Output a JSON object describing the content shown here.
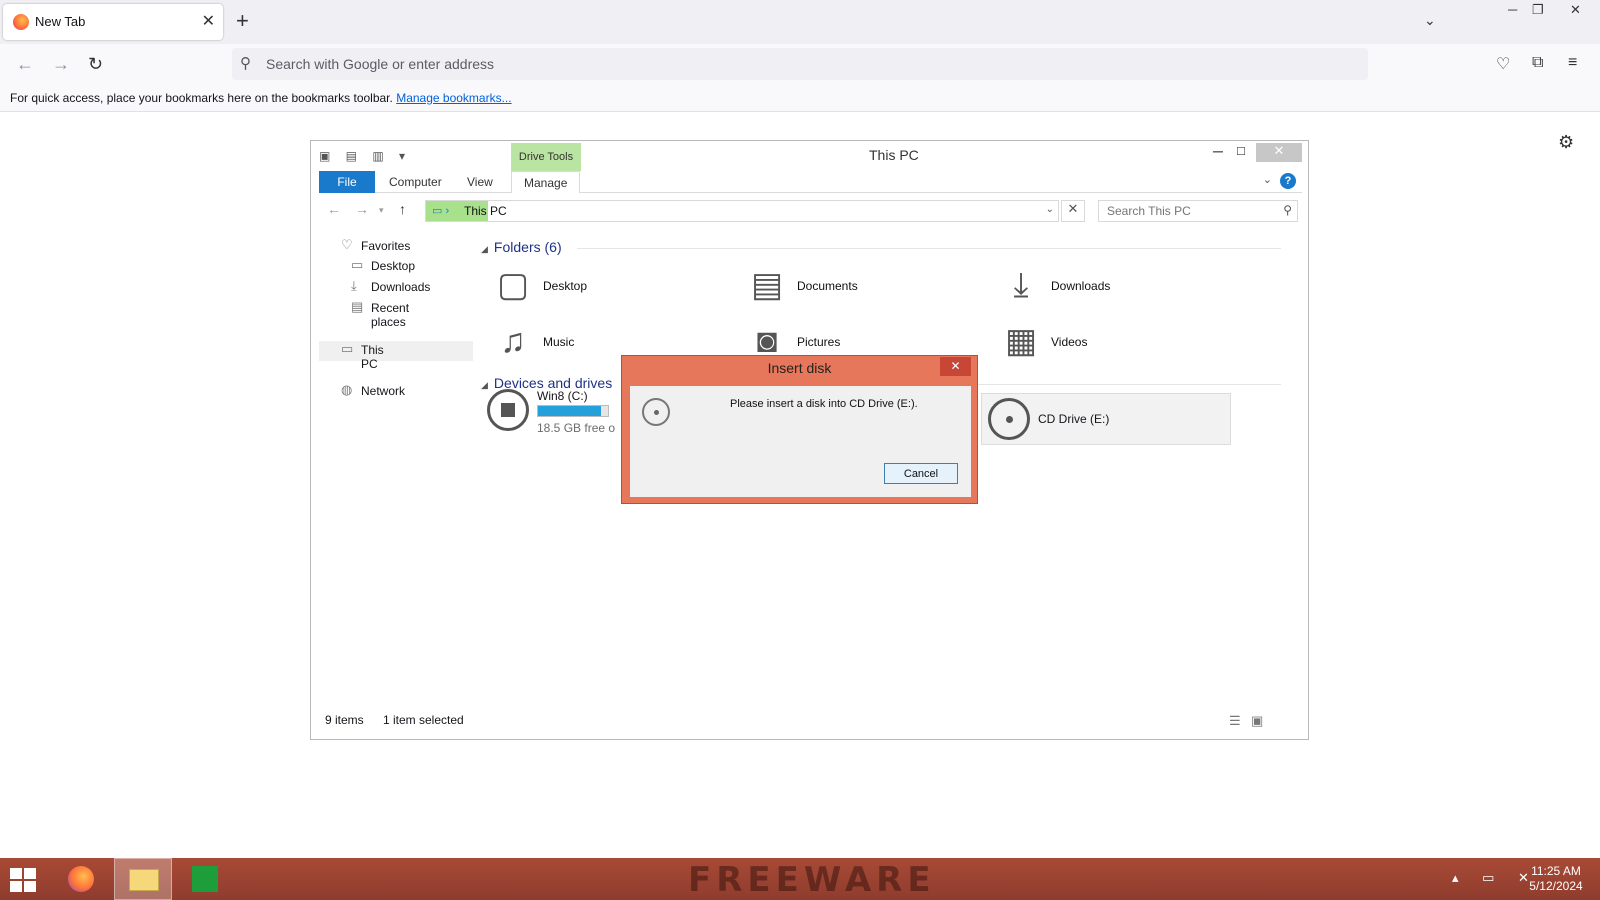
{
  "browser": {
    "tab_title": "New Tab",
    "tab_close": "✕",
    "new_tab": "+",
    "url_placeholder": "Search with Google or enter address",
    "bookmarks_text": "For quick access, place your bookmarks here on the bookmarks toolbar.",
    "bookmarks_link": "Manage bookmarks..."
  },
  "explorer": {
    "title": "This PC",
    "contextual_tab": "Drive Tools",
    "ribbon_tabs": [
      "File",
      "Computer",
      "View",
      "Manage"
    ],
    "breadcrumb": "This PC",
    "search_placeholder": "Search This PC",
    "nav": {
      "favorites": "Favorites",
      "desktop": "Desktop",
      "downloads": "Downloads",
      "recent": "Recent places",
      "this_pc": "This PC",
      "network": "Network"
    },
    "folders_header": "Folders (6)",
    "folders": [
      "Desktop",
      "Documents",
      "Downloads",
      "Music",
      "Pictures",
      "Videos"
    ],
    "devices_header": "Devices and drives",
    "drive_c": {
      "name": "Win8 (C:)",
      "free": "18.5 GB free o",
      "used_fraction": 0.9
    },
    "drive_e": {
      "name": "CD Drive (E:)"
    },
    "status_items": "9 items",
    "status_selected": "1 item selected"
  },
  "dialog": {
    "title": "Insert disk",
    "message": "Please insert a disk into CD Drive (E:).",
    "cancel": "Cancel",
    "close": "✕"
  },
  "taskbar": {
    "watermark": "FREEWARE",
    "time": "11:25 AM",
    "date": "5/12/2024"
  }
}
